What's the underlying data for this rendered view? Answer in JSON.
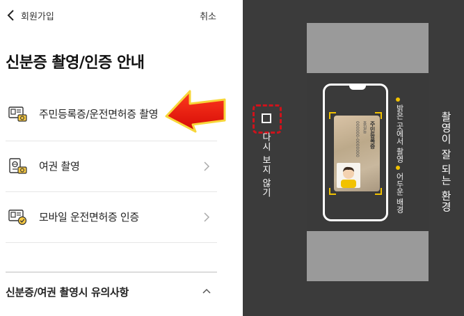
{
  "header": {
    "back_label": "회원가입",
    "cancel_label": "취소"
  },
  "page_title": "신분증 촬영/인증 안내",
  "menu": [
    {
      "label": "주민등록증/운전면허증 촬영",
      "icon": "id-card-camera-icon"
    },
    {
      "label": "여권 촬영",
      "icon": "passport-camera-icon"
    },
    {
      "label": "모바일 운전면허증 인증",
      "icon": "mobile-license-check-icon"
    }
  ],
  "caution_section": {
    "label": "신분증/여권 촬영시 유의사항"
  },
  "guide": {
    "dont_show_label": "다시 보지 않기",
    "environment_title": "촬영이 잘 되는 환경",
    "tips": [
      "밝은 곳에서 촬영",
      "어두운 배경"
    ],
    "card_title": "주민등록증",
    "card_name": "홍길동",
    "card_number": "000000-0000000"
  },
  "colors": {
    "accent": "#f2c200",
    "highlight": "#d0121b",
    "arrow": "#e8120c",
    "guide_bg": "#3b3b3b",
    "guide_gray": "#9a9a9a"
  }
}
